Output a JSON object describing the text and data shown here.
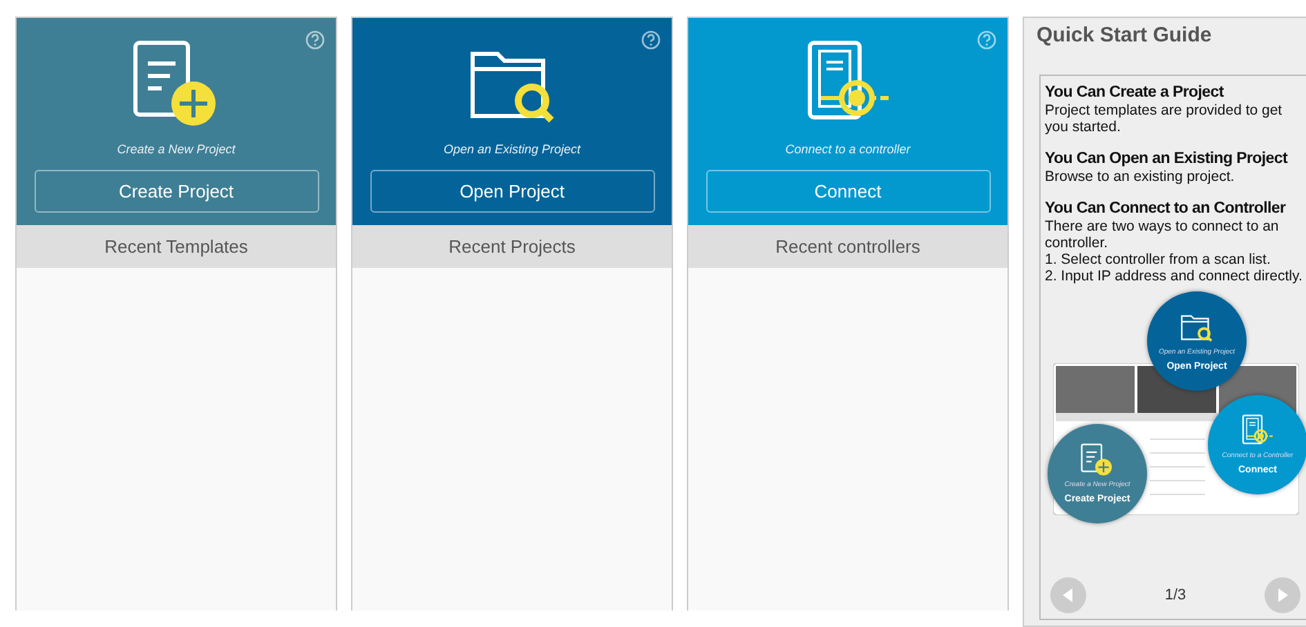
{
  "cards": [
    {
      "kind": "create",
      "caption": "Create a New Project",
      "button": "Create Project",
      "recent_header": "Recent Templates"
    },
    {
      "kind": "open",
      "caption": "Open an Existing Project",
      "button": "Open Project",
      "recent_header": "Recent Projects"
    },
    {
      "kind": "connect",
      "caption": "Connect to a controller",
      "button": "Connect",
      "recent_header": "Recent controllers"
    }
  ],
  "guide": {
    "title": "Quick Start Guide",
    "sections": [
      {
        "heading": "You Can Create a Project",
        "lines": [
          "Project templates are provided to get you started."
        ]
      },
      {
        "heading": "You Can Open an Existing Project",
        "lines": [
          "Browse to an existing project."
        ]
      },
      {
        "heading": "You Can Connect to an Controller",
        "lines": [
          "There are two ways to connect to an controller.",
          "1. Select controller from a scan list.",
          "2. Input IP address and connect directly."
        ]
      }
    ],
    "callouts": [
      {
        "kind": "open",
        "caption": "Open an Existing Project",
        "button": "Open Project"
      },
      {
        "kind": "connect",
        "caption": "Connect to a Controller",
        "button": "Connect"
      },
      {
        "kind": "create",
        "caption": "Create a New Project",
        "button": "Create Project"
      }
    ],
    "page": "1/3"
  }
}
